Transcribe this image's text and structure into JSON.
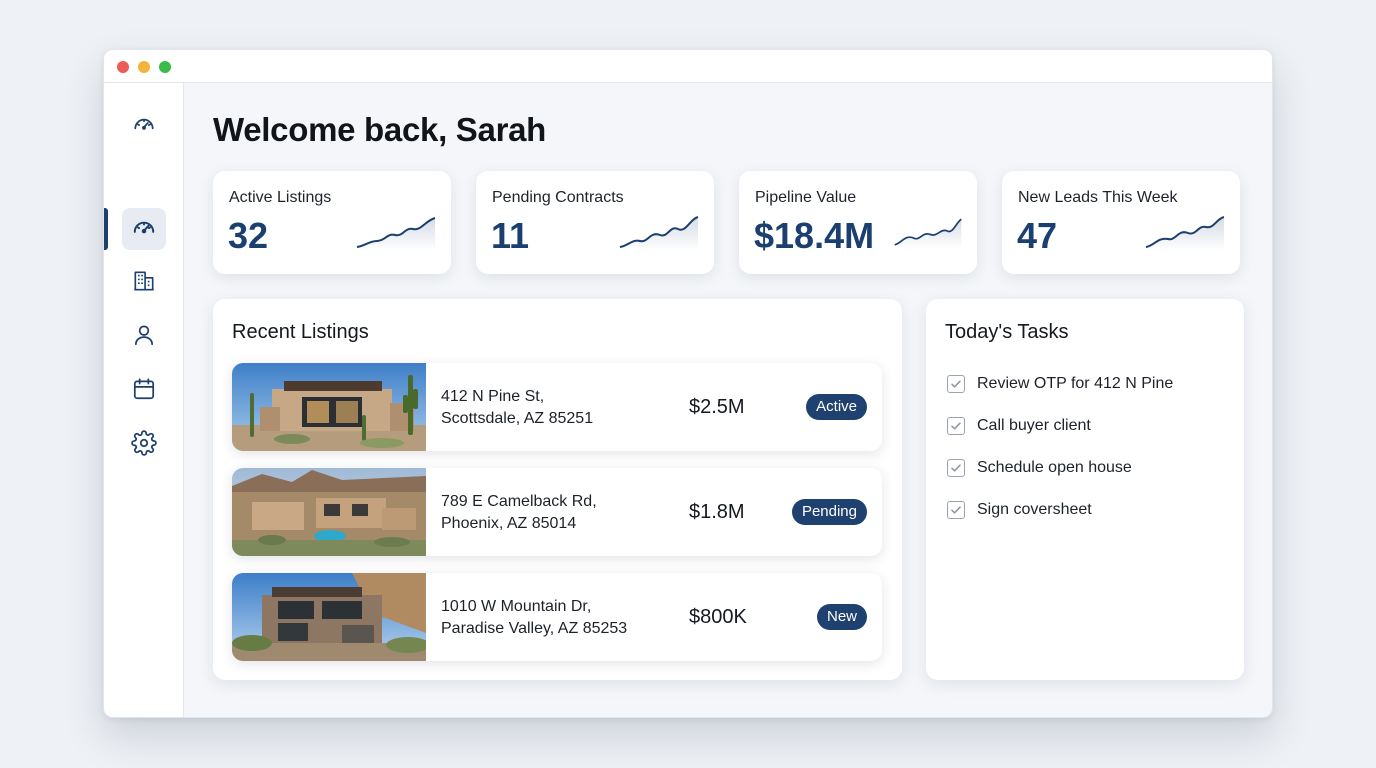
{
  "app": {
    "welcome": "Welcome back, Sarah"
  },
  "sidebar": {
    "items": [
      {
        "icon": "speedometer-icon",
        "active": false
      },
      {
        "icon": "dashboard-gauge-icon",
        "active": true
      },
      {
        "icon": "building-icon",
        "active": false
      },
      {
        "icon": "user-icon",
        "active": false
      },
      {
        "icon": "calendar-icon",
        "active": false
      },
      {
        "icon": "gear-icon",
        "active": false
      }
    ]
  },
  "stats": [
    {
      "label": "Active Listings",
      "value": "32"
    },
    {
      "label": "Pending Contracts",
      "value": "11"
    },
    {
      "label": "Pipeline Value",
      "value": "$18.4M"
    },
    {
      "label": "New Leads This Week",
      "value": "47"
    }
  ],
  "listings": {
    "title": "Recent Listings",
    "items": [
      {
        "address_line1": "412 N Pine St,",
        "address_line2": "Scottsdale, AZ 85251",
        "price": "$2.5M",
        "status": "Active"
      },
      {
        "address_line1": "789 E Camelback Rd,",
        "address_line2": "Phoenix, AZ 85014",
        "price": "$1.8M",
        "status": "Pending"
      },
      {
        "address_line1": "1010 W Mountain Dr,",
        "address_line2": "Paradise Valley, AZ 85253",
        "price": "$800K",
        "status": "New"
      }
    ]
  },
  "tasks": {
    "title": "Today's Tasks",
    "items": [
      {
        "label": "Review OTP for 412 N Pine",
        "checked": true
      },
      {
        "label": "Call buyer client",
        "checked": true
      },
      {
        "label": "Schedule open house",
        "checked": true
      },
      {
        "label": "Sign coversheet",
        "checked": true
      }
    ]
  },
  "colors": {
    "accent": "#1b3f6e",
    "badge": "#1e416f",
    "background": "#eef1f5"
  }
}
